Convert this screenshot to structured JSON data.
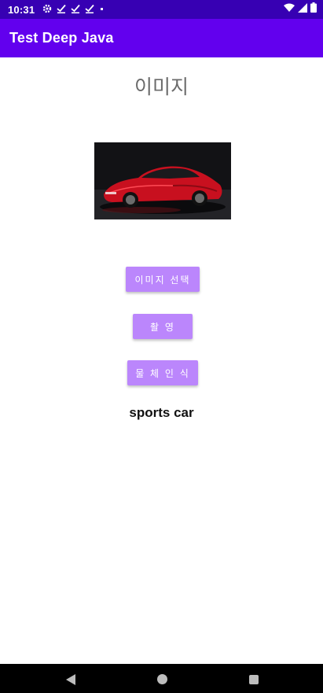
{
  "status_bar": {
    "time": "10:31",
    "notification_icons": [
      "gear-icon",
      "download-done-icon",
      "download-done-icon",
      "download-done-icon",
      "dot-icon"
    ],
    "right_icons": [
      "wifi-icon",
      "cell-signal-icon",
      "battery-icon"
    ]
  },
  "app_bar": {
    "title": "Test Deep Java",
    "color": "#6200EE"
  },
  "main": {
    "heading": "이미지",
    "image_icon": "red-sports-car-photo",
    "buttons": {
      "select_image": "이미지 선택",
      "take_photo": "촬 영",
      "object_detection": "물 체 인 식"
    },
    "button_color": "#BB86FC",
    "result_text": "sports car"
  },
  "nav_bar": {
    "icons": [
      "back-icon",
      "home-icon",
      "recents-icon"
    ]
  }
}
